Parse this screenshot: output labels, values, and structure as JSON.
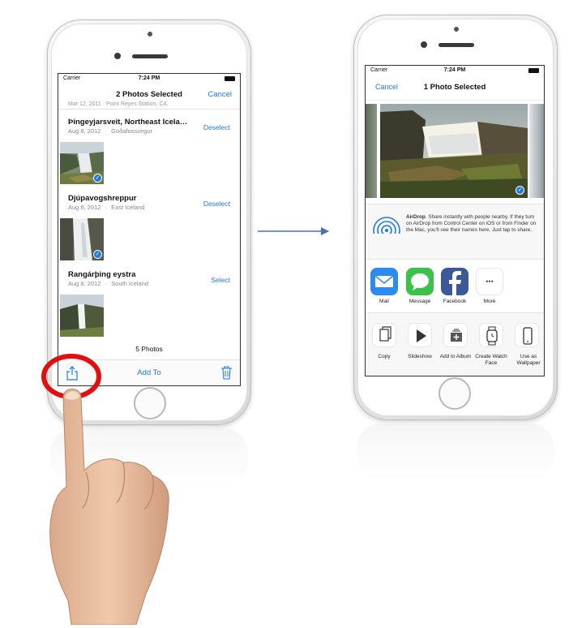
{
  "left_phone": {
    "status": {
      "carrier": "Carrier",
      "time": "7:24 PM"
    },
    "nav": {
      "title": "2 Photos Selected",
      "cancel": "Cancel"
    },
    "partial_row": "Mar 12, 2011 · Point Reyes Station, CA",
    "moments": [
      {
        "title": "Þingeyjarsveit, Northeast Icela…",
        "date": "Aug 8, 2012",
        "place": "Goðafossvegur",
        "action": "Deselect",
        "selected": true
      },
      {
        "title": "Djúpavogshreppur",
        "date": "Aug 8, 2012",
        "place": "East Iceland",
        "action": "Deselect",
        "selected": true
      },
      {
        "title": "Rangárþing eystra",
        "date": "Aug 8, 2012",
        "place": "South Iceland",
        "action": "Select",
        "selected": false
      }
    ],
    "dot": "·",
    "checkmark": "✓",
    "photo_count": "5 Photos",
    "toolbar": {
      "share_icon": "share-icon",
      "add_to": "Add To",
      "trash_icon": "trash-icon"
    }
  },
  "right_phone": {
    "status": {
      "carrier": "Carrier",
      "time": "7:24 PM"
    },
    "nav": {
      "cancel": "Cancel",
      "title": "1 Photo Selected"
    },
    "checkmark": "✓",
    "airdrop": {
      "title": "AirDrop",
      "text": ". Share instantly with people nearby. If they turn on AirDrop from Control Center on iOS or from Finder on the Mac, you'll see their names here. Just tap to share."
    },
    "share_apps": [
      {
        "label": "Mail",
        "icon": "mail-icon",
        "color": "#2a8cf0"
      },
      {
        "label": "Message",
        "icon": "message-icon",
        "color": "#3ac24a"
      },
      {
        "label": "Facebook",
        "icon": "facebook-icon",
        "color": "#3b5998"
      },
      {
        "label": "More",
        "icon": "more-icon",
        "color": "#ffffff",
        "glyph": "•••"
      }
    ],
    "actions": [
      {
        "label": "Copy",
        "icon": "copy-icon"
      },
      {
        "label": "Slideshow",
        "icon": "play-icon"
      },
      {
        "label": "Add to Album",
        "icon": "add-album-icon"
      },
      {
        "label": "Create Watch Face",
        "icon": "watch-icon"
      },
      {
        "label": "Use as Wallpaper",
        "icon": "phone-icon"
      }
    ]
  },
  "arrow_color": "#4a6fb5",
  "tap_highlight_color": "#e01010"
}
